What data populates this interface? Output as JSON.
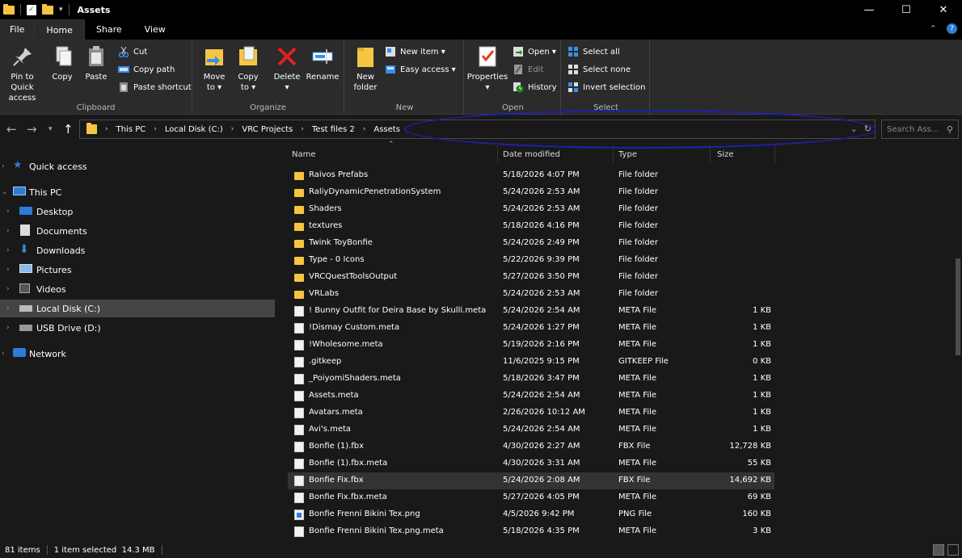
{
  "window": {
    "title": "Assets",
    "minimize": "—",
    "maximize": "☐",
    "close": "✕"
  },
  "tabs": [
    "File",
    "Home",
    "Share",
    "View"
  ],
  "ribbon": {
    "clipboard": {
      "label": "Clipboard",
      "pin_line1": "Pin to Quick",
      "pin_line2": "access",
      "copy": "Copy",
      "paste": "Paste",
      "cut": "Cut",
      "copy_path": "Copy path",
      "paste_shortcut": "Paste shortcut"
    },
    "organize": {
      "label": "Organize",
      "move_to_line1": "Move",
      "move_to_line2": "to ▾",
      "copy_to_line1": "Copy",
      "copy_to_line2": "to ▾",
      "delete": "Delete",
      "delete_arrow": "▾",
      "rename": "Rename"
    },
    "new": {
      "label": "New",
      "new_folder_line1": "New",
      "new_folder_line2": "folder",
      "new_item": "New item ▾",
      "easy_access": "Easy access ▾"
    },
    "open": {
      "label": "Open",
      "properties": "Properties",
      "properties_arrow": "▾",
      "open": "Open ▾",
      "edit": "Edit",
      "history": "History"
    },
    "select": {
      "label": "Select",
      "select_all": "Select all",
      "select_none": "Select none",
      "invert_selection": "Invert selection"
    }
  },
  "address": {
    "crumbs": [
      "This PC",
      "Local Disk (C:)",
      "VRC Projects",
      "Test files 2",
      "Assets"
    ],
    "search_placeholder": "Search Ass..."
  },
  "nav": {
    "quick_access": "Quick access",
    "this_pc": "This PC",
    "desktop": "Desktop",
    "documents": "Documents",
    "downloads": "Downloads",
    "pictures": "Pictures",
    "videos": "Videos",
    "local_disk": "Local Disk (C:)",
    "usb_drive": "USB Drive (D:)",
    "network": "Network"
  },
  "columns": {
    "name": "Name",
    "date": "Date modified",
    "type": "Type",
    "size": "Size"
  },
  "files": [
    {
      "name": "Raivos Prefabs",
      "date": "5/18/2026 4:07 PM",
      "type": "File folder",
      "size": "",
      "icon": "folder"
    },
    {
      "name": "RaliyDynamicPenetrationSystem",
      "date": "5/24/2026 2:53 AM",
      "type": "File folder",
      "size": "",
      "icon": "folder"
    },
    {
      "name": "Shaders",
      "date": "5/24/2026 2:53 AM",
      "type": "File folder",
      "size": "",
      "icon": "folder"
    },
    {
      "name": "textures",
      "date": "5/18/2026 4:16 PM",
      "type": "File folder",
      "size": "",
      "icon": "folder"
    },
    {
      "name": "Twink ToyBonfie",
      "date": "5/24/2026 2:49 PM",
      "type": "File folder",
      "size": "",
      "icon": "folder"
    },
    {
      "name": "Type - 0 Icons",
      "date": "5/22/2026 9:39 PM",
      "type": "File folder",
      "size": "",
      "icon": "folder"
    },
    {
      "name": "VRCQuestToolsOutput",
      "date": "5/27/2026 3:50 PM",
      "type": "File folder",
      "size": "",
      "icon": "folder"
    },
    {
      "name": "VRLabs",
      "date": "5/24/2026 2:53 AM",
      "type": "File folder",
      "size": "",
      "icon": "folder"
    },
    {
      "name": "! Bunny Outfit for Deira Base by Skulli.meta",
      "date": "5/24/2026 2:54 AM",
      "type": "META File",
      "size": "1 KB",
      "icon": "doc"
    },
    {
      "name": "!Dismay Custom.meta",
      "date": "5/24/2026 1:27 PM",
      "type": "META File",
      "size": "1 KB",
      "icon": "doc"
    },
    {
      "name": "!Wholesome.meta",
      "date": "5/19/2026 2:16 PM",
      "type": "META File",
      "size": "1 KB",
      "icon": "doc"
    },
    {
      "name": ".gitkeep",
      "date": "11/6/2025 9:15 PM",
      "type": "GITKEEP File",
      "size": "0 KB",
      "icon": "doc"
    },
    {
      "name": "_PoiyomiShaders.meta",
      "date": "5/18/2026 3:47 PM",
      "type": "META File",
      "size": "1 KB",
      "icon": "doc"
    },
    {
      "name": "Assets.meta",
      "date": "5/24/2026 2:54 AM",
      "type": "META File",
      "size": "1 KB",
      "icon": "doc"
    },
    {
      "name": "Avatars.meta",
      "date": "2/26/2026 10:12 AM",
      "type": "META File",
      "size": "1 KB",
      "icon": "doc"
    },
    {
      "name": "Avi's.meta",
      "date": "5/24/2026 2:54 AM",
      "type": "META File",
      "size": "1 KB",
      "icon": "doc"
    },
    {
      "name": "Bonfie (1).fbx",
      "date": "4/30/2026 2:27 AM",
      "type": "FBX File",
      "size": "12,728 KB",
      "icon": "doc"
    },
    {
      "name": "Bonfie (1).fbx.meta",
      "date": "4/30/2026 3:31 AM",
      "type": "META File",
      "size": "55 KB",
      "icon": "doc"
    },
    {
      "name": "Bonfie Fix.fbx",
      "date": "5/24/2026 2:08 AM",
      "type": "FBX File",
      "size": "14,692 KB",
      "icon": "doc",
      "selected": true
    },
    {
      "name": "Bonfie Fix.fbx.meta",
      "date": "5/27/2026 4:05 PM",
      "type": "META File",
      "size": "69 KB",
      "icon": "doc"
    },
    {
      "name": "Bonfie Frenni Bikini Tex.png",
      "date": "4/5/2026 9:42 PM",
      "type": "PNG File",
      "size": "160 KB",
      "icon": "png"
    },
    {
      "name": "Bonfie Frenni Bikini Tex.png.meta",
      "date": "5/18/2026 4:35 PM",
      "type": "META File",
      "size": "3 KB",
      "icon": "doc"
    }
  ],
  "status": {
    "items": "81 items",
    "selected": "1 item selected  14.3 MB"
  }
}
